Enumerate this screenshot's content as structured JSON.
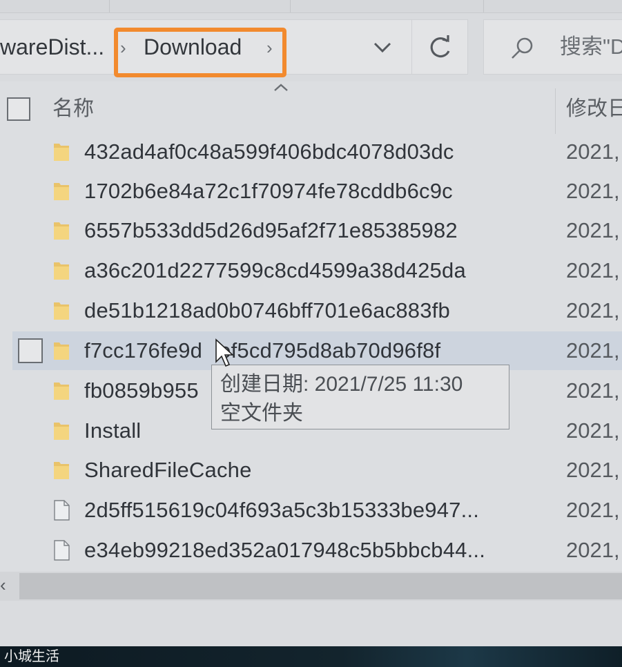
{
  "breadcrumb": {
    "parent": "wareDist...",
    "current": "Download",
    "highlight_color": "#f28a2e"
  },
  "search": {
    "text": "搜索\"D"
  },
  "columns": {
    "name": "名称",
    "date": "修改日"
  },
  "rows": [
    {
      "name": "432ad4af0c48a599f406bdc4078d03dc",
      "date": "2021,",
      "type": "folder"
    },
    {
      "name": "1702b6e84a72c1f70974fe78cddb6c9c",
      "date": "2021,",
      "type": "folder"
    },
    {
      "name": "6557b533dd5d26d95af2f71e85385982",
      "date": "2021,",
      "type": "folder"
    },
    {
      "name": "a36c201d2277599c8cd4599a38d425da",
      "date": "2021,",
      "type": "folder"
    },
    {
      "name": "de51b1218ad0b0746bff701e6ac883fb",
      "date": "2021,",
      "type": "folder"
    },
    {
      "name": "f7cc176fe9d",
      "name_rest": "ef5cd795d8ab70d96f8f",
      "date": "2021,",
      "type": "folder",
      "selected": true
    },
    {
      "name": "fb0859b955",
      "date": "2021,",
      "type": "folder"
    },
    {
      "name": "Install",
      "date": "2021,",
      "type": "folder"
    },
    {
      "name": "SharedFileCache",
      "date": "2021,",
      "type": "folder"
    },
    {
      "name": "2d5ff515619c04f693a5c3b15333be947...",
      "date": "2021,",
      "type": "file"
    },
    {
      "name": "e34eb99218ed352a017948c5b5bbcb44...",
      "date": "2021,",
      "type": "file"
    }
  ],
  "tooltip": {
    "created": "创建日期: 2021/7/25 11:30",
    "kind": "空文件夹"
  },
  "watermark": "小城生活"
}
